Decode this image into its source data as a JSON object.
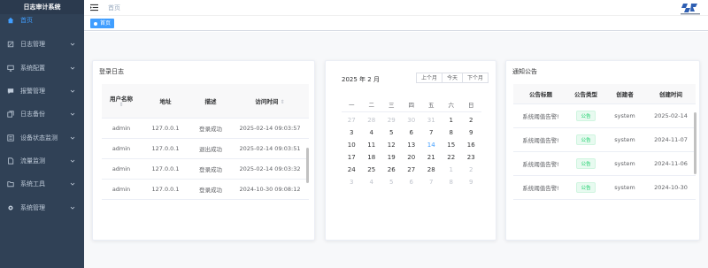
{
  "app": {
    "title": "日志审计系统"
  },
  "sidebar": {
    "items": [
      {
        "label": "首页",
        "icon": "home-icon",
        "active": true,
        "has_children": false
      },
      {
        "label": "日志管理",
        "icon": "edit-icon",
        "has_children": true
      },
      {
        "label": "系统配置",
        "icon": "monitor-icon",
        "has_children": true
      },
      {
        "label": "报警管理",
        "icon": "message-icon",
        "has_children": true
      },
      {
        "label": "日志备份",
        "icon": "copy-icon",
        "has_children": true
      },
      {
        "label": "设备状态监测",
        "icon": "list-icon",
        "has_children": true
      },
      {
        "label": "流量监测",
        "icon": "document-icon",
        "has_children": true
      },
      {
        "label": "系统工具",
        "icon": "folder-icon",
        "has_children": true
      },
      {
        "label": "系统管理",
        "icon": "gear-icon",
        "has_children": true
      }
    ]
  },
  "header": {
    "breadcrumb": "首页"
  },
  "tags": {
    "active": "首页"
  },
  "login_log": {
    "title": "登录日志",
    "columns": [
      "用户名称",
      "地址",
      "描述",
      "访问时间"
    ],
    "rows": [
      [
        "admin",
        "127.0.0.1",
        "登录成功",
        "2025-02-14 09:03:57"
      ],
      [
        "admin",
        "127.0.0.1",
        "退出成功",
        "2025-02-14 09:03:51"
      ],
      [
        "admin",
        "127.0.0.1",
        "登录成功",
        "2025-02-14 09:03:32"
      ],
      [
        "admin",
        "127.0.0.1",
        "登录成功",
        "2024-10-30 09:08:12"
      ]
    ]
  },
  "calendar": {
    "title": "2025 年 2 月",
    "buttons": [
      "上个月",
      "今天",
      "下个月"
    ],
    "weekdays": [
      "一",
      "二",
      "三",
      "四",
      "五",
      "六",
      "日"
    ],
    "weeks": [
      [
        {
          "d": "27",
          "o": true
        },
        {
          "d": "28",
          "o": true
        },
        {
          "d": "29",
          "o": true
        },
        {
          "d": "30",
          "o": true
        },
        {
          "d": "31",
          "o": true
        },
        {
          "d": "1"
        },
        {
          "d": "2"
        }
      ],
      [
        {
          "d": "3"
        },
        {
          "d": "4"
        },
        {
          "d": "5"
        },
        {
          "d": "6"
        },
        {
          "d": "7"
        },
        {
          "d": "8"
        },
        {
          "d": "9"
        }
      ],
      [
        {
          "d": "10"
        },
        {
          "d": "11"
        },
        {
          "d": "12"
        },
        {
          "d": "13"
        },
        {
          "d": "14",
          "t": true
        },
        {
          "d": "15"
        },
        {
          "d": "16"
        }
      ],
      [
        {
          "d": "17"
        },
        {
          "d": "18"
        },
        {
          "d": "19"
        },
        {
          "d": "20"
        },
        {
          "d": "21"
        },
        {
          "d": "22"
        },
        {
          "d": "23"
        }
      ],
      [
        {
          "d": "24"
        },
        {
          "d": "25"
        },
        {
          "d": "26"
        },
        {
          "d": "27"
        },
        {
          "d": "28"
        },
        {
          "d": "1",
          "o": true
        },
        {
          "d": "2",
          "o": true
        }
      ],
      [
        {
          "d": "3",
          "o": true
        },
        {
          "d": "4",
          "o": true
        },
        {
          "d": "5",
          "o": true
        },
        {
          "d": "6",
          "o": true
        },
        {
          "d": "7",
          "o": true
        },
        {
          "d": "8",
          "o": true
        },
        {
          "d": "9",
          "o": true
        }
      ]
    ]
  },
  "notices": {
    "title": "通知公告",
    "columns": [
      "公告标题",
      "公告类型",
      "创建者",
      "创建时间"
    ],
    "rows": [
      [
        "系统阈值告警!",
        "公告",
        "system",
        "2025-02-14"
      ],
      [
        "系统阈值告警!",
        "公告",
        "system",
        "2024-11-07"
      ],
      [
        "系统阈值告警!",
        "公告",
        "system",
        "2024-11-06"
      ],
      [
        "系统阈值告警!",
        "公告",
        "system",
        "2024-10-30"
      ]
    ]
  },
  "colors": {
    "sidebar_bg": "#304156",
    "accent": "#409eff",
    "badge_green": "#13ce66"
  }
}
